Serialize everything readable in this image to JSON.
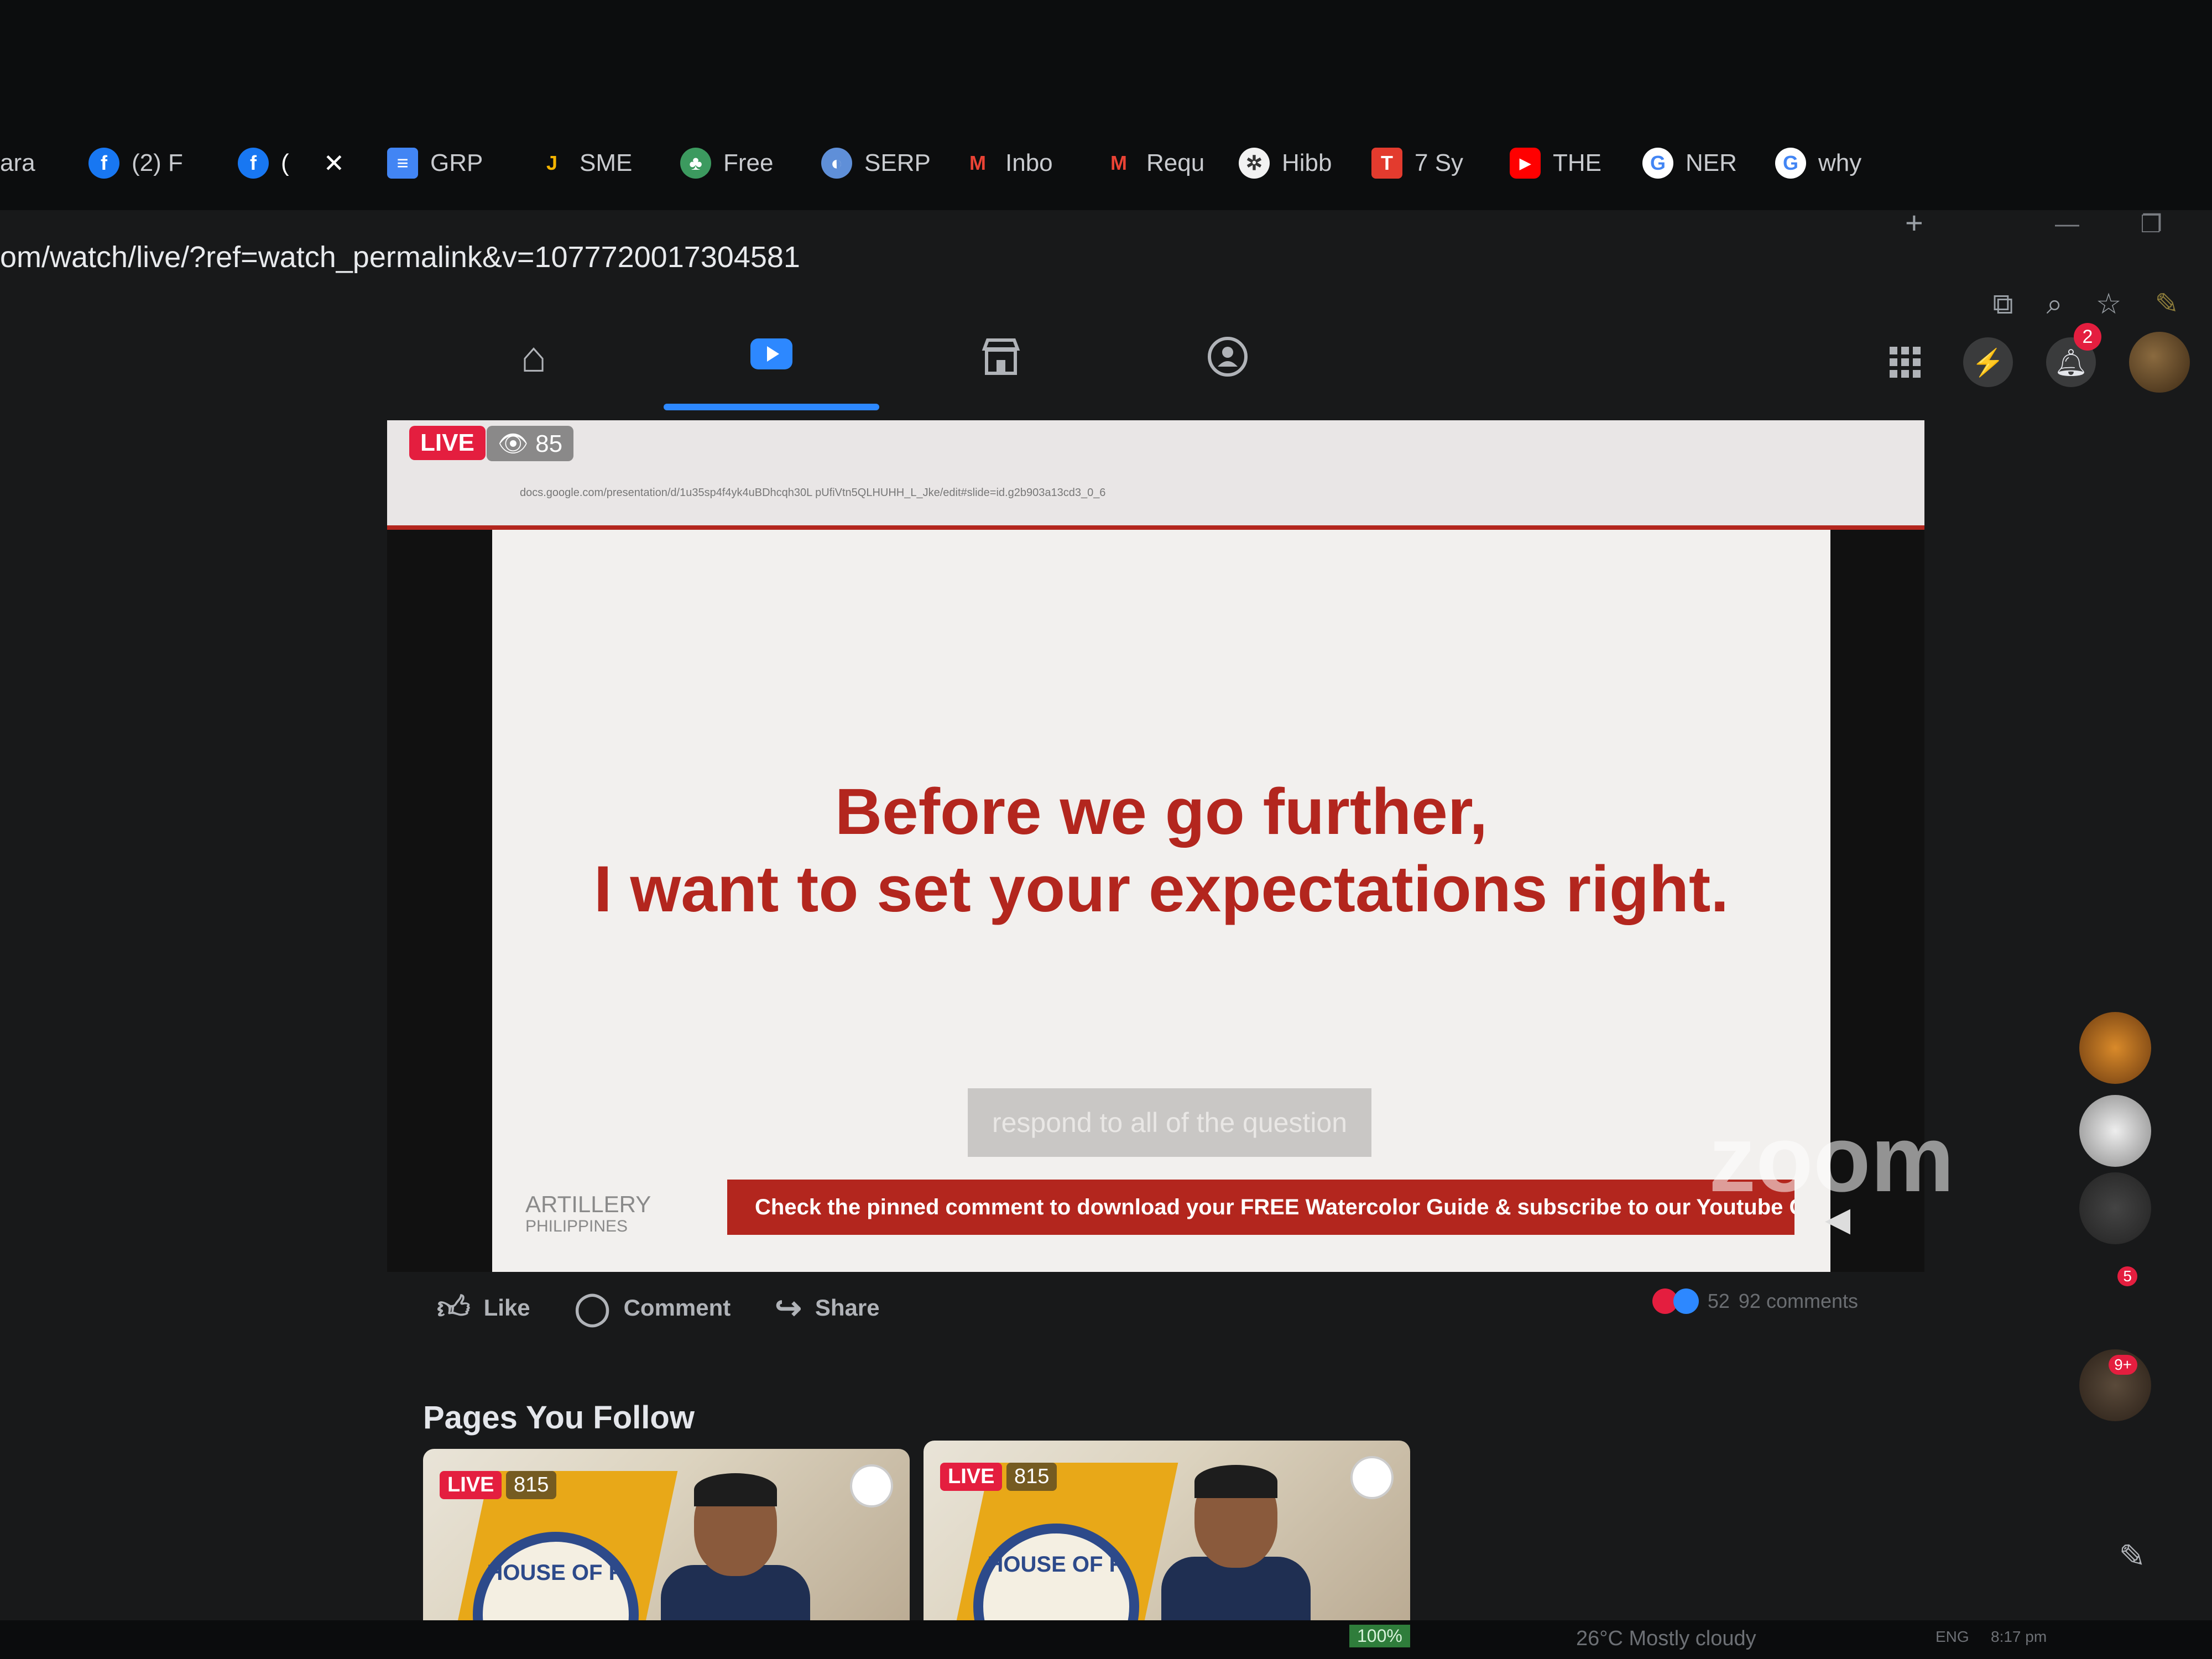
{
  "browser": {
    "tabs": [
      {
        "label": "ara",
        "icon": "tab-fragment"
      },
      {
        "label": "(2) F",
        "icon": "facebook-icon",
        "color": "#1877f2"
      },
      {
        "label": "(",
        "icon": "facebook-icon",
        "color": "#1877f2",
        "active": true,
        "close": "✕"
      },
      {
        "label": "GRP",
        "icon": "docs-icon",
        "color": "#4285f4"
      },
      {
        "label": "SME",
        "icon": "j-icon",
        "color": "#f4b400"
      },
      {
        "label": "Free",
        "icon": "leaf-icon",
        "color": "#3c9a5f"
      },
      {
        "label": "SERP",
        "icon": "serp-icon",
        "color": "#5f8fd8"
      },
      {
        "label": "Inbo",
        "icon": "gmail-icon",
        "color": "#ea4335"
      },
      {
        "label": "Requ",
        "icon": "gmail-icon",
        "color": "#ea4335"
      },
      {
        "label": "Hibb",
        "icon": "openai-icon",
        "color": "#777777"
      },
      {
        "label": "7 Sy",
        "icon": "t-icon",
        "color": "#e33b2e"
      },
      {
        "label": "THE",
        "icon": "youtube-icon",
        "color": "#ff0000"
      },
      {
        "label": "NER",
        "icon": "google-icon",
        "color": "#4285f4"
      },
      {
        "label": "why",
        "icon": "google-icon",
        "color": "#4285f4"
      }
    ],
    "new_tab": "+",
    "url": "om/watch/live/?ref=watch_permalink&v=1077720017304581"
  },
  "nav": {
    "tabs": [
      "home-icon",
      "watch-icon",
      "marketplace-icon",
      "groups-icon"
    ],
    "active": "watch-icon",
    "notification_count": "2"
  },
  "video": {
    "live_label": "LIVE",
    "viewers": "85",
    "shared_url": "docs.google.com/presentation/d/1u35sp4f4yk4uBDhcqh30L pUfiVtn5QLHUHH_L_Jke/edit#slide=id.g2b903a13cd3_0_6",
    "slide_line1": "Before we go further,",
    "slide_line2": "I want to set your expectations right.",
    "caption": "respond to all of the question",
    "brand_name": "ARTILLERY",
    "brand_sub": "PHILIPPINES",
    "pinned_text": "Check the pinned comment to download your FREE Watercolor Guide & subscribe to our Youtube Channel",
    "watermark": "zoom"
  },
  "actions": {
    "like": "Like",
    "comment": "Comment",
    "share": "Share",
    "reaction_count": "52",
    "comments_count": "92 comments"
  },
  "pages_you_follow": {
    "title": "Pages You Follow",
    "cards": [
      {
        "live": "LIVE",
        "views": "815",
        "seal_text": "HOUSE OF R"
      },
      {
        "live": "LIVE",
        "views": "815",
        "seal_text": "HOUSE OF R"
      }
    ]
  },
  "contacts": {
    "badges": [
      "5",
      "9+"
    ]
  },
  "taskbar": {
    "zoom_level": "100%",
    "weather": "26°C  Mostly cloudy",
    "lang": "ENG",
    "time": "8:17 pm"
  },
  "colors": {
    "fb_blue": "#2d88ff",
    "live_red": "#e41e3f",
    "slide_red": "#b3261e",
    "background": "#18191a"
  }
}
